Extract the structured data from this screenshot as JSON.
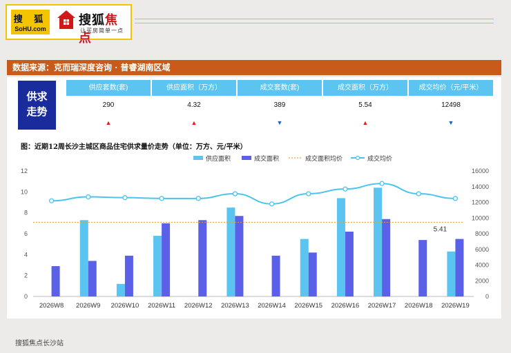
{
  "header": {
    "sohu_logo_cn": "搜 狐",
    "sohu_logo_en": "SoHU.com",
    "brand_black": "搜狐",
    "brand_red": "焦点",
    "slogan": "让买房简单一点"
  },
  "source": "数据来源：克而瑞深度咨询 · 普睿湖南区域",
  "summary": {
    "label": [
      "供求",
      "走势"
    ],
    "columns": [
      {
        "header": "供应套数(套)",
        "value": "290",
        "trend": "up"
      },
      {
        "header": "供应面积（万方）",
        "value": "4.32",
        "trend": "up"
      },
      {
        "header": "成交套数(套)",
        "value": "389",
        "trend": "down"
      },
      {
        "header": "成交面积（万方）",
        "value": "5.54",
        "trend": "up"
      },
      {
        "header": "成交均价（元/平米）",
        "value": "12498",
        "trend": "down"
      }
    ]
  },
  "chart_title": "图：近期12周长沙主城区商品住宅供求量价走势（单位：万方、元/平米）",
  "chart_data": {
    "type": "bar",
    "categories": [
      "2026W8",
      "2026W9",
      "2026W10",
      "2026W11",
      "2026W12",
      "2026W13",
      "2026W14",
      "2026W15",
      "2026W16",
      "2026W17",
      "2026W18",
      "2026W19"
    ],
    "series": [
      {
        "name": "供应面积",
        "type": "bar",
        "axis": "left",
        "color": "#5bc4f1",
        "values": [
          0,
          7.3,
          1.2,
          5.8,
          0,
          8.5,
          0,
          5.5,
          9.4,
          10.4,
          0,
          4.3
        ]
      },
      {
        "name": "成交面积",
        "type": "bar",
        "axis": "left",
        "color": "#5b60e8",
        "values": [
          2.9,
          3.4,
          3.9,
          7.0,
          7.3,
          7.7,
          3.9,
          4.2,
          6.2,
          7.4,
          5.4,
          5.5
        ]
      },
      {
        "name": "成交面积均价",
        "type": "line",
        "style": "dotted",
        "axis": "left",
        "color": "#f0a020",
        "values": [
          7.1,
          7.1,
          7.1,
          7.1,
          7.1,
          7.1,
          7.1,
          7.1,
          7.1,
          7.1,
          7.1,
          7.1
        ]
      },
      {
        "name": "成交均价",
        "type": "line",
        "axis": "right",
        "color": "#49c4ee",
        "values": [
          12200,
          12700,
          12600,
          12500,
          12500,
          13100,
          11800,
          13100,
          13700,
          14400,
          13100,
          12500
        ]
      }
    ],
    "annotation": "5.41",
    "ylim_left": [
      0,
      12
    ],
    "yticks_left": [
      0,
      2,
      4,
      6,
      8,
      10,
      12
    ],
    "ylim_right": [
      0,
      16000
    ],
    "yticks_right": [
      0,
      2000,
      4000,
      6000,
      8000,
      10000,
      12000,
      14000,
      16000
    ],
    "legend_position": "top"
  },
  "footer": "搜狐焦点长沙站",
  "colors": {
    "accent_orange": "#c85b1a",
    "header_blue": "#5bc4f1",
    "label_navy": "#1a2b9b",
    "up_red": "#e0201c",
    "down_blue": "#1e62b4"
  }
}
